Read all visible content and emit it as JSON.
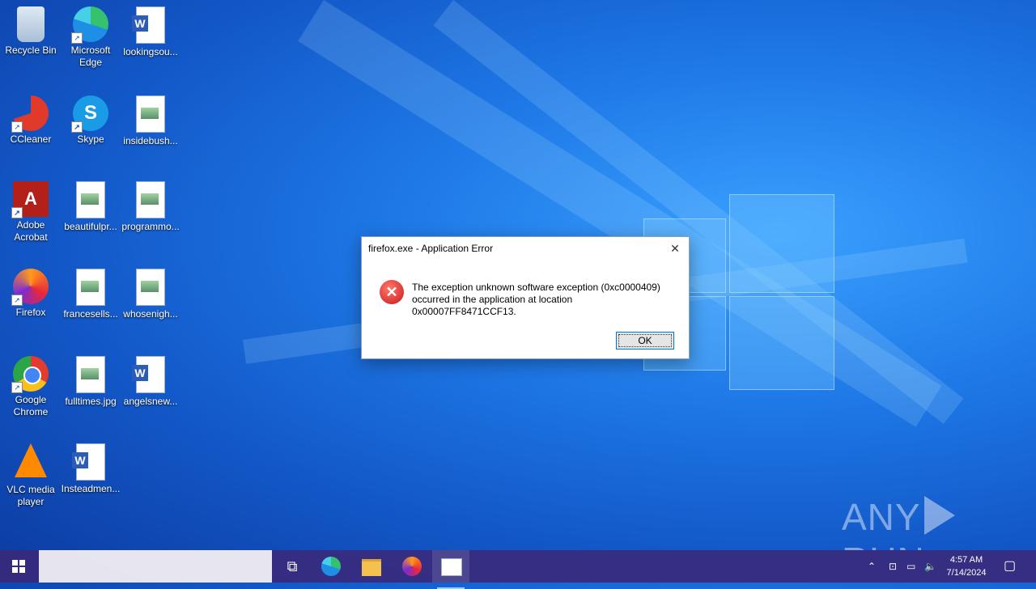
{
  "desktop": {
    "icons": [
      {
        "label": "Recycle Bin",
        "icon": "recycle-bin-icon"
      },
      {
        "label": "Microsoft Edge",
        "icon": "edge-icon"
      },
      {
        "label": "lookingsou...",
        "icon": "word-document-icon"
      },
      {
        "label": "CCleaner",
        "icon": "ccleaner-icon"
      },
      {
        "label": "Skype",
        "icon": "skype-icon"
      },
      {
        "label": "insidebush...",
        "icon": "image-file-icon"
      },
      {
        "label": "Adobe Acrobat",
        "icon": "adobe-acrobat-icon"
      },
      {
        "label": "beautifulpr...",
        "icon": "image-file-icon"
      },
      {
        "label": "programmo...",
        "icon": "image-file-icon"
      },
      {
        "label": "Firefox",
        "icon": "firefox-icon"
      },
      {
        "label": "francesells...",
        "icon": "image-file-icon"
      },
      {
        "label": "whosenigh...",
        "icon": "image-file-icon"
      },
      {
        "label": "Google Chrome",
        "icon": "chrome-icon"
      },
      {
        "label": "fulltimes.jpg",
        "icon": "image-file-icon"
      },
      {
        "label": "angelsnew...",
        "icon": "word-document-icon"
      },
      {
        "label": "VLC media player",
        "icon": "vlc-icon"
      },
      {
        "label": "Insteadmen...",
        "icon": "word-document-icon"
      }
    ]
  },
  "dialog": {
    "title": "firefox.exe - Application Error",
    "message": "The exception unknown software exception (0xc0000409) occurred in the application at location 0x00007FF8471CCF13.",
    "ok_label": "OK",
    "close_glyph": "✕"
  },
  "watermark": {
    "left": "ANY",
    "right": "RUN"
  },
  "taskbar": {
    "search_placeholder": "",
    "clock_time": "4:57 AM",
    "clock_date": "7/14/2024"
  },
  "colors": {
    "accent": "#0078d7",
    "error": "#c8161a"
  }
}
